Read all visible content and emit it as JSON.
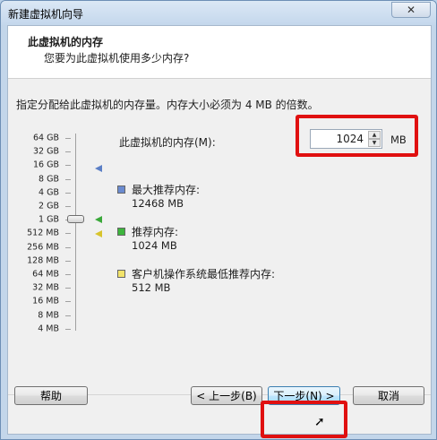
{
  "window": {
    "title": "新建虚拟机向导",
    "close_glyph": "✕"
  },
  "header": {
    "title": "此虚拟机的内存",
    "subtitle": "您要为此虚拟机使用多少内存?"
  },
  "instruction": "指定分配给此虚拟机的内存量。内存大小必须为 4 MB 的倍数。",
  "slider": {
    "scale_labels": [
      "64 GB",
      "32 GB",
      "16 GB",
      "8 GB",
      "4 GB",
      "2 GB",
      "1 GB",
      "512 MB",
      "256 MB",
      "128 MB",
      "64 MB",
      "32 MB",
      "16 MB",
      "8 MB",
      "4 MB"
    ],
    "current_label": "1 GB"
  },
  "memory": {
    "label": "此虚拟机的内存(M):",
    "value": "1024",
    "unit": "MB",
    "spin_up": "▲",
    "spin_down": "▼"
  },
  "legend": [
    {
      "title": "最大推荐内存:",
      "value": "12468 MB",
      "color": "#6b8bd0"
    },
    {
      "title": "推荐内存:",
      "value": "1024 MB",
      "color": "#3db53d"
    },
    {
      "title": "客户机操作系统最低推荐内存:",
      "value": "512 MB",
      "color": "#f2e36a"
    }
  ],
  "buttons": {
    "help": "帮助",
    "back": "< 上一步(B)",
    "next": "下一步(N) >",
    "cancel": "取消"
  },
  "annotation_color": "#e01010"
}
